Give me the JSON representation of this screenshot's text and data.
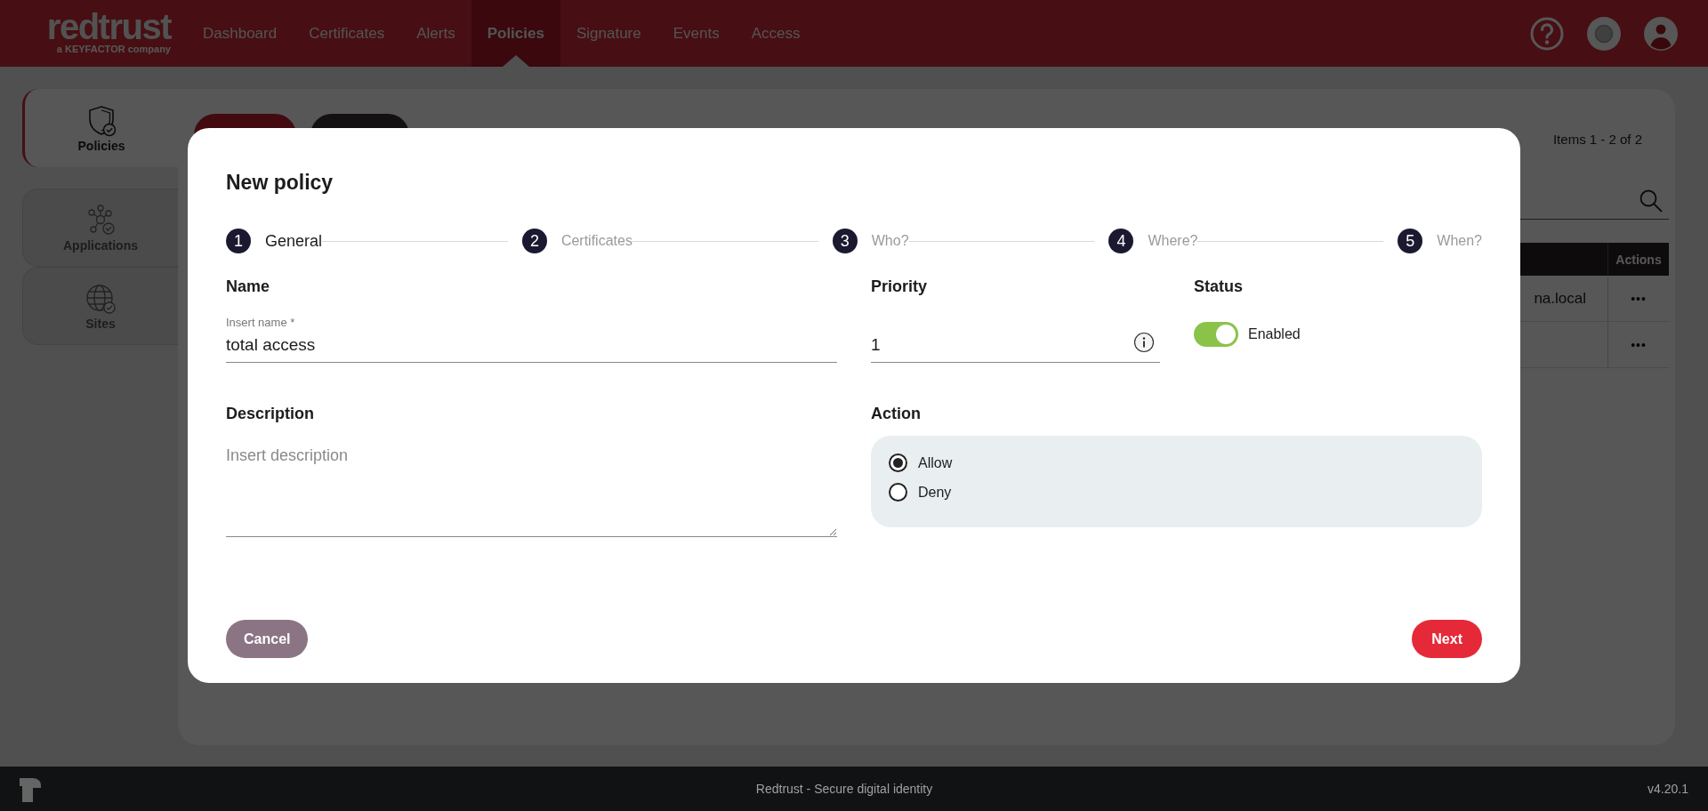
{
  "header": {
    "logo": "redtrust",
    "tagline": "a KEYFACTOR company",
    "nav": [
      {
        "label": "Dashboard",
        "selected": false
      },
      {
        "label": "Certificates",
        "selected": false
      },
      {
        "label": "Alerts",
        "selected": false
      },
      {
        "label": "Policies",
        "selected": true
      },
      {
        "label": "Signature",
        "selected": false
      },
      {
        "label": "Events",
        "selected": false
      },
      {
        "label": "Access",
        "selected": false
      }
    ]
  },
  "sidebar": {
    "items": [
      {
        "label": "Policies",
        "kind": "shield",
        "selected": true
      },
      {
        "label": "Applications",
        "kind": "nodes",
        "selected": false
      },
      {
        "label": "Sites",
        "kind": "globe",
        "selected": false
      }
    ]
  },
  "panel": {
    "pager": "Items 1 - 2 of 2",
    "table": {
      "columns": [
        "Actions"
      ],
      "rows": [
        {
          "column_1": "na.local",
          "actions": "•••"
        },
        {
          "actions": "•••"
        }
      ]
    }
  },
  "modal": {
    "title": "New policy",
    "steps": [
      {
        "number": "1",
        "label": "General",
        "selected": true
      },
      {
        "number": "2",
        "label": "Certificates",
        "selected": false
      },
      {
        "number": "3",
        "label": "Who?",
        "selected": false
      },
      {
        "number": "4",
        "label": "Where?",
        "selected": false
      },
      {
        "number": "5",
        "label": "When?",
        "selected": false
      }
    ],
    "name": {
      "heading": "Name",
      "label": "Insert name *",
      "value": "total access"
    },
    "priority": {
      "heading": "Priority",
      "value": "1"
    },
    "status": {
      "heading": "Status",
      "on": true,
      "label": "Enabled"
    },
    "description": {
      "heading": "Description",
      "placeholder": "Insert description"
    },
    "action": {
      "heading": "Action",
      "options": [
        {
          "label": "Allow",
          "selected": true
        },
        {
          "label": "Deny",
          "selected": false
        }
      ]
    },
    "buttons": {
      "cancel": "Cancel",
      "next": "Next"
    }
  },
  "footer": {
    "text": "Redtrust - Secure digital identity",
    "version": "v4.20.1"
  }
}
